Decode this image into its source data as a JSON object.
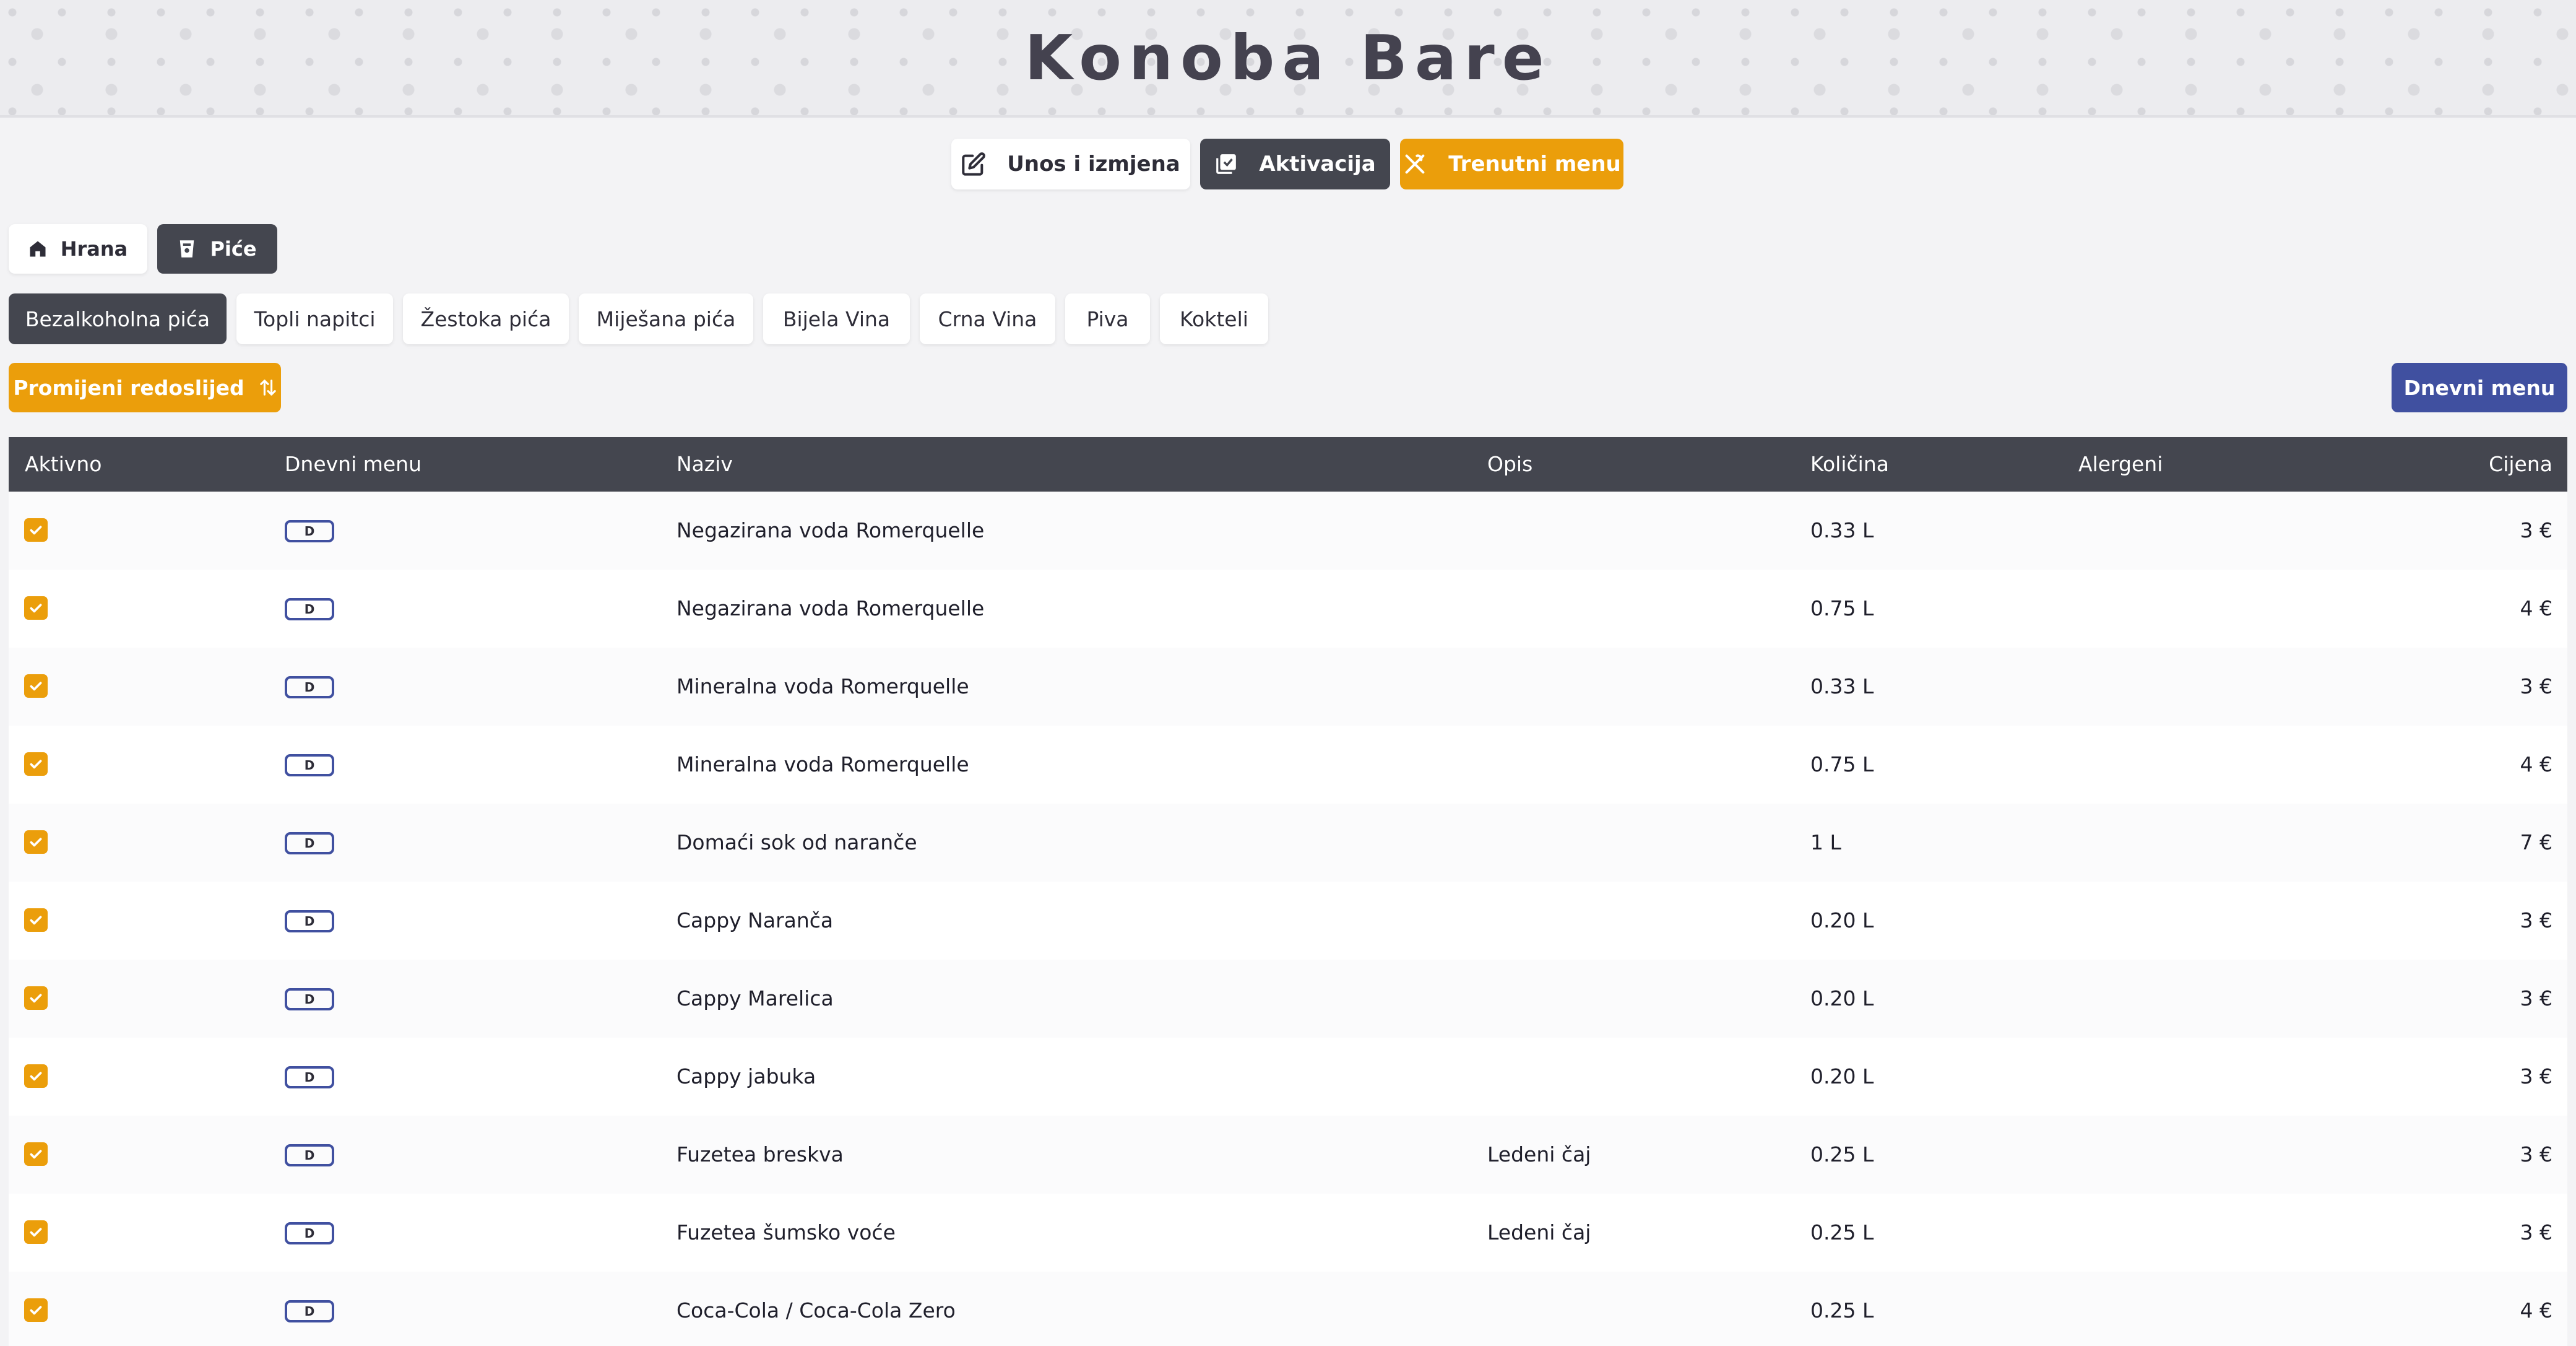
{
  "header": {
    "title": "Konoba Bare"
  },
  "top_actions": [
    {
      "label": "Unos i izmjena",
      "icon": "edit-icon"
    },
    {
      "label": "Aktivacija",
      "icon": "copy-icon"
    },
    {
      "label": "Trenutni menu",
      "icon": "utensils-icon"
    }
  ],
  "menu_types": [
    {
      "label": "Hrana",
      "icon": "home-icon"
    },
    {
      "label": "Piće",
      "icon": "cup-icon",
      "selected": true
    }
  ],
  "categories": [
    {
      "label": "Bezalkoholna pića",
      "selected": true
    },
    {
      "label": "Topli napitci"
    },
    {
      "label": "Žestoka pića"
    },
    {
      "label": "Miješana pića"
    },
    {
      "label": "Bijela Vina"
    },
    {
      "label": "Crna Vina"
    },
    {
      "label": "Piva"
    },
    {
      "label": "Kokteli"
    }
  ],
  "reorder_button": {
    "label": "Promijeni redoslijed",
    "icon": "sort-arrows-icon"
  },
  "daily_menu_button": {
    "label": "Dnevni menu"
  },
  "table": {
    "headers": {
      "active": "Aktivno",
      "daily": "Dnevni menu",
      "name": "Naziv",
      "description": "Opis",
      "quantity": "Količina",
      "allergens": "Alergeni",
      "price": "Cijena"
    },
    "rows": [
      {
        "active": true,
        "daily_badge": "D",
        "name": "Negazirana voda Romerquelle",
        "description": "",
        "quantity": "0.33 L",
        "allergens": "",
        "price": "3 €"
      },
      {
        "active": true,
        "daily_badge": "D",
        "name": "Negazirana voda Romerquelle",
        "description": "",
        "quantity": "0.75 L",
        "allergens": "",
        "price": "4 €"
      },
      {
        "active": true,
        "daily_badge": "D",
        "name": "Mineralna voda Romerquelle",
        "description": "",
        "quantity": "0.33 L",
        "allergens": "",
        "price": "3 €"
      },
      {
        "active": true,
        "daily_badge": "D",
        "name": "Mineralna voda Romerquelle",
        "description": "",
        "quantity": "0.75 L",
        "allergens": "",
        "price": "4 €"
      },
      {
        "active": true,
        "daily_badge": "D",
        "name": "Domaći sok od naranče",
        "description": "",
        "quantity": "1 L",
        "allergens": "",
        "price": "7 €"
      },
      {
        "active": true,
        "daily_badge": "D",
        "name": "Cappy Naranča",
        "description": "",
        "quantity": "0.20 L",
        "allergens": "",
        "price": "3 €"
      },
      {
        "active": true,
        "daily_badge": "D",
        "name": "Cappy Marelica",
        "description": "",
        "quantity": "0.20 L",
        "allergens": "",
        "price": "3 €"
      },
      {
        "active": true,
        "daily_badge": "D",
        "name": "Cappy jabuka",
        "description": "",
        "quantity": "0.20 L",
        "allergens": "",
        "price": "3 €"
      },
      {
        "active": true,
        "daily_badge": "D",
        "name": "Fuzetea breskva",
        "description": "Ledeni čaj",
        "quantity": "0.25 L",
        "allergens": "",
        "price": "3 €"
      },
      {
        "active": true,
        "daily_badge": "D",
        "name": "Fuzetea šumsko voće",
        "description": "Ledeni čaj",
        "quantity": "0.25 L",
        "allergens": "",
        "price": "3 €"
      },
      {
        "active": true,
        "daily_badge": "D",
        "name": "Coca-Cola / Coca-Cola Zero",
        "description": "",
        "quantity": "0.25 L",
        "allergens": "",
        "price": "4 €"
      }
    ]
  },
  "colors": {
    "accent_orange": "#eb9e0b",
    "dark": "#44464f",
    "blue": "#4050a0",
    "background": "#f3f3f5"
  }
}
